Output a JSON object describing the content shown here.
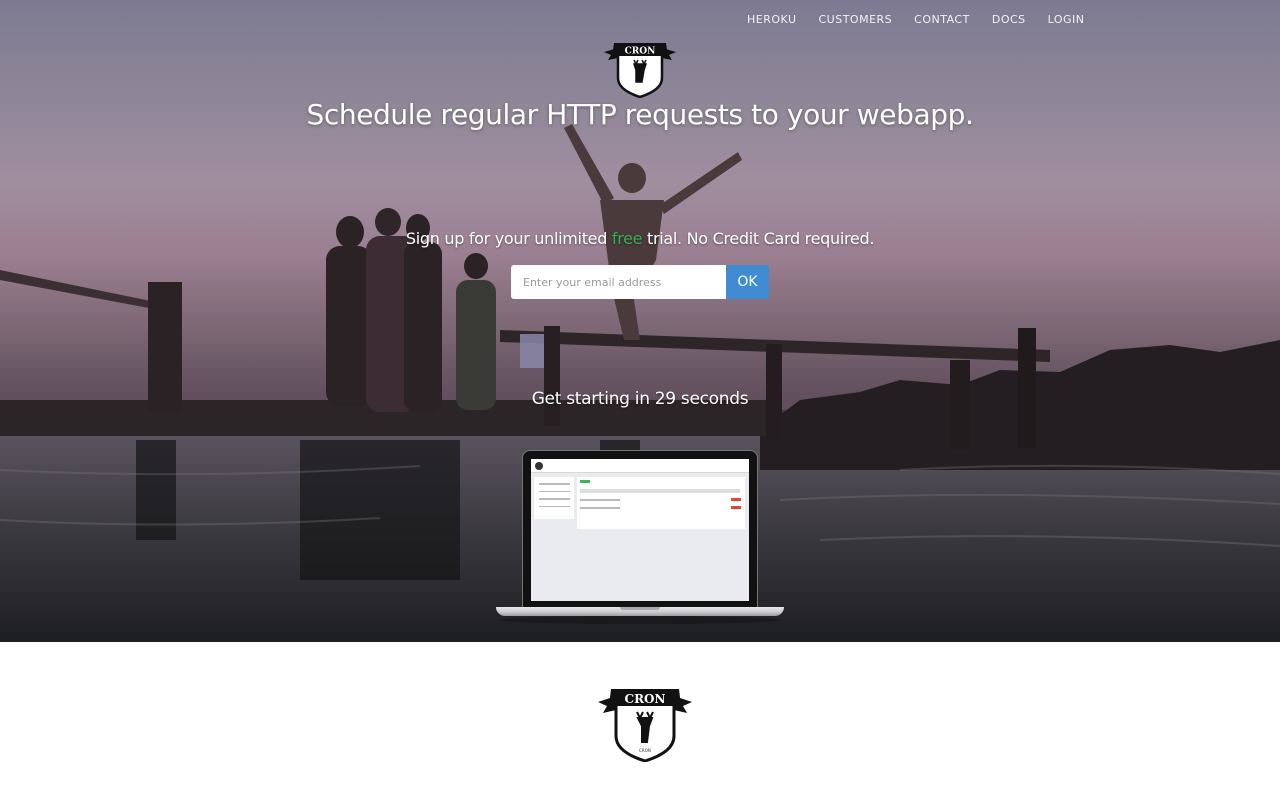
{
  "nav": {
    "items": [
      {
        "label": "HEROKU"
      },
      {
        "label": "CUSTOMERS"
      },
      {
        "label": "CONTACT"
      },
      {
        "label": "DOCS"
      },
      {
        "label": "LOGIN"
      }
    ]
  },
  "logo": {
    "text": "CRON",
    "subtext": "CRON"
  },
  "hero": {
    "headline": "Schedule regular HTTP requests to your webapp.",
    "signup_prefix": "Sign up for your unlimited ",
    "signup_highlight": "free",
    "signup_suffix": " trial. No Credit Card required.",
    "email_placeholder": "Enter your email address",
    "ok_label": "OK",
    "getting_started": "Get starting in 29 seconds"
  },
  "colors": {
    "accent_blue": "#3f8cd2",
    "free_green": "#2fb34a"
  }
}
